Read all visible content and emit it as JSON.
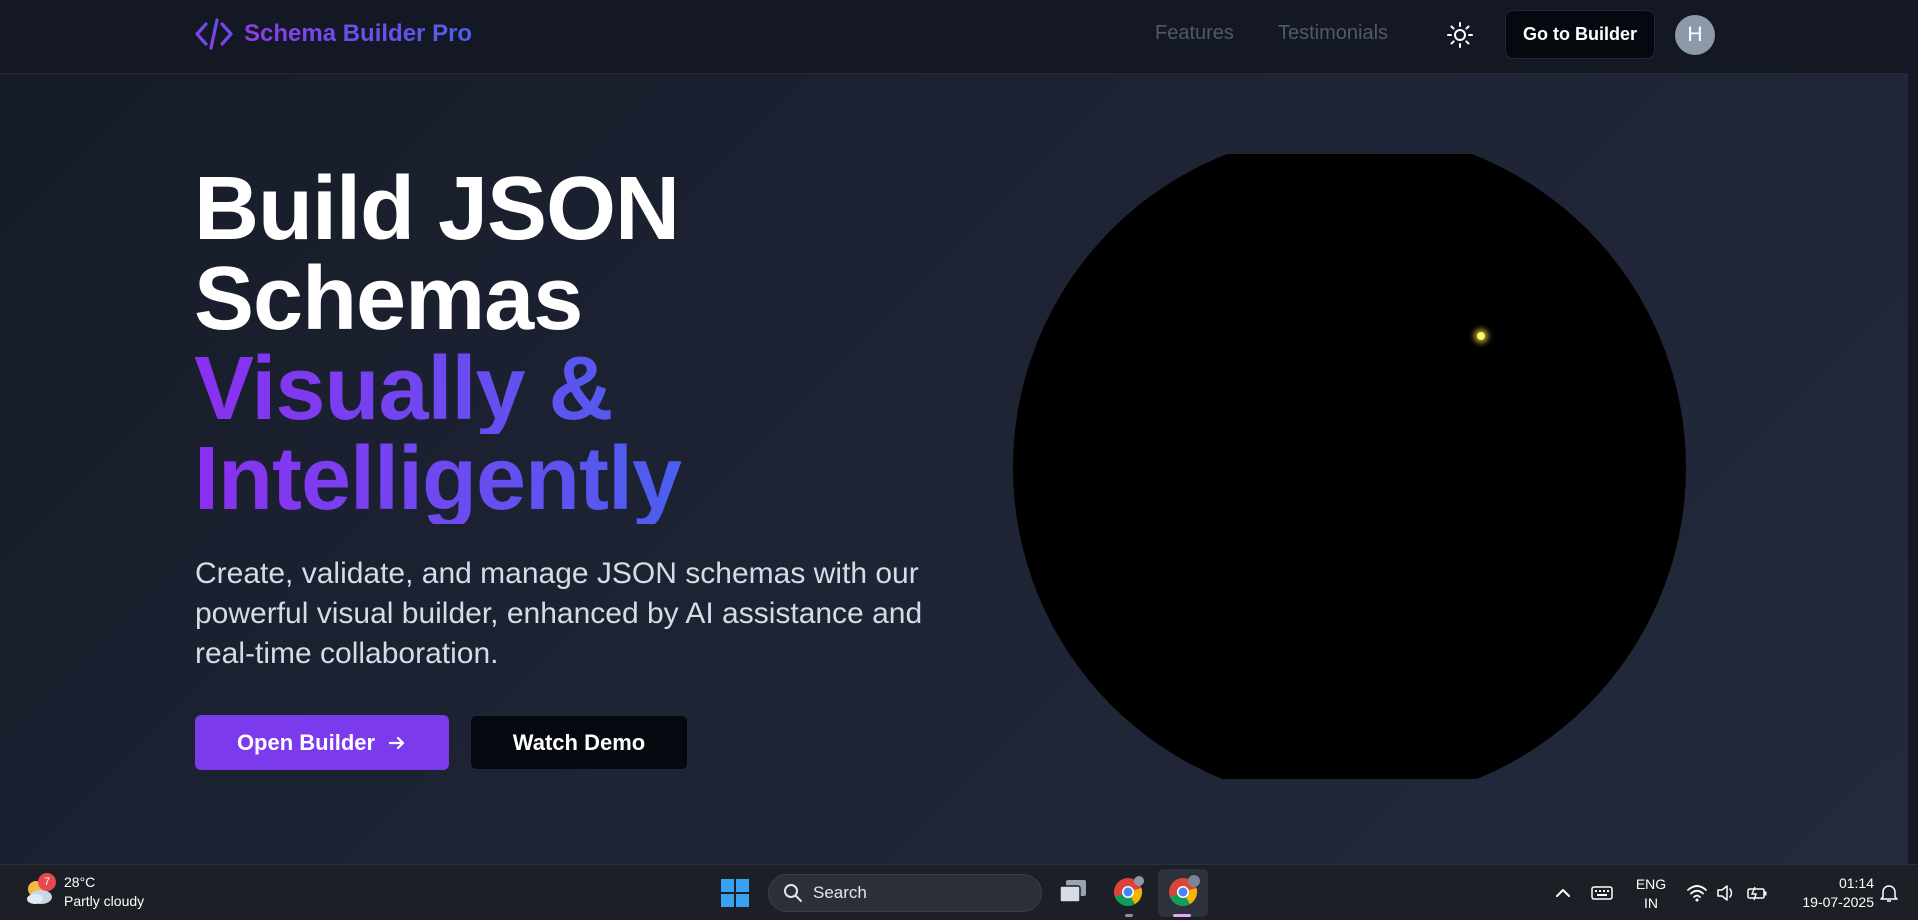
{
  "navbar": {
    "brand": "Schema Builder Pro",
    "links": [
      "Features",
      "Testimonials"
    ],
    "cta": "Go to Builder",
    "avatar_initial": "H"
  },
  "hero": {
    "title_line1": "Build JSON",
    "title_line2": "Schemas",
    "title_line3": "Visually &",
    "title_line4": "Intelligently",
    "subtitle": "Create, validate, and manage JSON schemas with our powerful visual builder, enhanced by AI assistance and real-time collaboration.",
    "primary_button": "Open Builder",
    "secondary_button": "Watch Demo"
  },
  "colors": {
    "accent": "#7c3aed",
    "gradient_start": "#8b2ff0",
    "gradient_end": "#4a5ff0",
    "background": "#1d2333"
  },
  "taskbar": {
    "weather_temp": "28°C",
    "weather_desc": "Partly cloudy",
    "weather_badge": "7",
    "search_placeholder": "Search",
    "language_line1": "ENG",
    "language_line2": "IN",
    "time": "01:14",
    "date": "19-07-2025"
  }
}
